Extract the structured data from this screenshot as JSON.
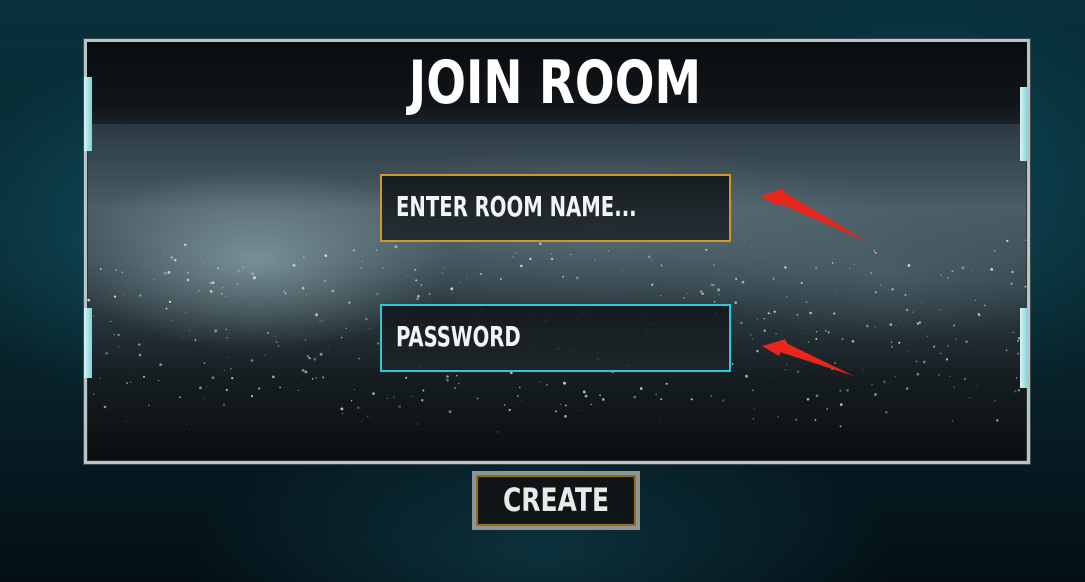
{
  "dialog": {
    "title": "JOIN ROOM"
  },
  "room_field": {
    "placeholder": "ENTER ROOM NAME..."
  },
  "password_field": {
    "placeholder": "PASSWORD"
  },
  "actions": {
    "create_label": "CREATE"
  },
  "colors": {
    "room_border": "#d4962b",
    "password_border": "#2fc6d6",
    "panel_frame": "#b9c4c4",
    "annotation_arrow": "#e8261c"
  }
}
